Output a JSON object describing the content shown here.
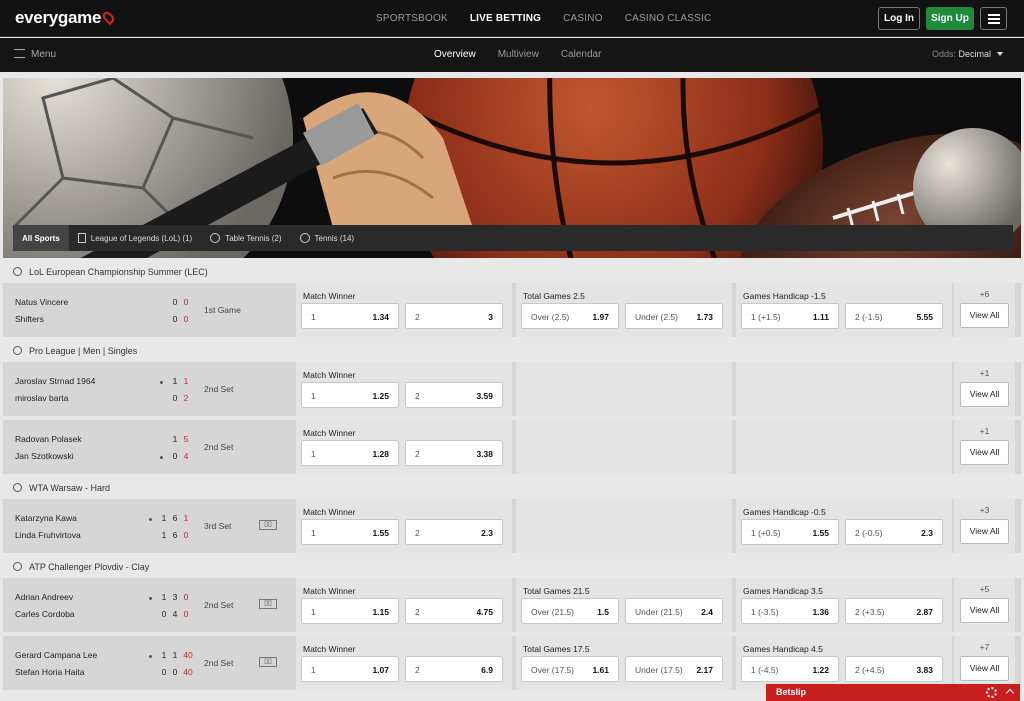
{
  "header": {
    "logo": "everygame",
    "nav": [
      "SPORTSBOOK",
      "LIVE BETTING",
      "CASINO",
      "CASINO CLASSIC"
    ],
    "active_nav": "LIVE BETTING",
    "login": "Log In",
    "signup": "Sign Up"
  },
  "subheader": {
    "menu": "Menu",
    "tabs": [
      "Overview",
      "Multiview",
      "Calendar"
    ],
    "active_tab": "Overview",
    "odds_label": "Odds:",
    "odds_value": "Decimal"
  },
  "sport_tabs": [
    "All Sports",
    "League of Legends (LoL) (1)",
    "Table Tennis (2)",
    "Tennis (14)"
  ],
  "leagues": [
    {
      "name": "LoL European Championship Summer (LEC)",
      "icon": "lol-icon",
      "matches": [
        {
          "p1": "Natus Vincere",
          "p2": "Shifters",
          "s1": [
            "0",
            "0"
          ],
          "s2": [
            "0",
            "0"
          ],
          "period": "1st Game",
          "stats": false,
          "markets": [
            {
              "title": "Match Winner",
              "odds": [
                [
                  "1",
                  "1.34"
                ],
                [
                  "2",
                  "3"
                ]
              ]
            },
            {
              "title": "Total Games 2.5",
              "odds": [
                [
                  "Over (2.5)",
                  "1.97"
                ],
                [
                  "Under (2.5)",
                  "1.73"
                ]
              ]
            },
            {
              "title": "Games Handicap -1.5",
              "odds": [
                [
                  "1 (+1.5)",
                  "1.11"
                ],
                [
                  "2 (-1.5)",
                  "5.55"
                ]
              ]
            }
          ],
          "more": "+6",
          "view_all": "View All"
        }
      ]
    },
    {
      "name": "Pro League | Men | Singles",
      "icon": "table-tennis-icon",
      "matches": [
        {
          "p1": "Jaroslav Strnad 1964",
          "p2": "miroslav barta",
          "s1": [
            "1",
            "1"
          ],
          "s2": [
            "0",
            "2"
          ],
          "serve": 1,
          "period": "2nd Set",
          "stats": false,
          "markets": [
            {
              "title": "Match Winner",
              "odds": [
                [
                  "1",
                  "1.25"
                ],
                [
                  "2",
                  "3.59"
                ]
              ]
            },
            null,
            null
          ],
          "more": "+1",
          "view_all": "View All"
        },
        {
          "p1": "Radovan Polasek",
          "p2": "Jan Szotkowski",
          "s1": [
            "1",
            "5"
          ],
          "s2": [
            "0",
            "4"
          ],
          "serve": 2,
          "period": "2nd Set",
          "stats": false,
          "markets": [
            {
              "title": "Match Winner",
              "odds": [
                [
                  "1",
                  "1.28"
                ],
                [
                  "2",
                  "3.38"
                ]
              ]
            },
            null,
            null
          ],
          "more": "+1",
          "view_all": "View All"
        }
      ]
    },
    {
      "name": "WTA Warsaw - Hard",
      "icon": "tennis-icon",
      "matches": [
        {
          "p1": "Katarzyna Kawa",
          "p2": "Linda Fruhvirtova",
          "s1": [
            "1",
            "6",
            "1"
          ],
          "s2": [
            "1",
            "6",
            "0"
          ],
          "serve": 1,
          "period": "3rd Set",
          "stats": true,
          "markets": [
            {
              "title": "Match Winner",
              "odds": [
                [
                  "1",
                  "1.55"
                ],
                [
                  "2",
                  "2.3"
                ]
              ]
            },
            null,
            {
              "title": "Games Handicap -0.5",
              "odds": [
                [
                  "1 (+0.5)",
                  "1.55"
                ],
                [
                  "2 (-0.5)",
                  "2.3"
                ]
              ]
            }
          ],
          "more": "+3",
          "view_all": "View All"
        }
      ]
    },
    {
      "name": "ATP Challenger Plovdiv - Clay",
      "icon": "tennis-icon",
      "matches": [
        {
          "p1": "Adrian Andreev",
          "p2": "Carles Cordoba",
          "s1": [
            "1",
            "3",
            "0"
          ],
          "s2": [
            "0",
            "4",
            "0"
          ],
          "serve": 1,
          "period": "2nd Set",
          "stats": true,
          "markets": [
            {
              "title": "Match Winner",
              "odds": [
                [
                  "1",
                  "1.15"
                ],
                [
                  "2",
                  "4.75"
                ]
              ]
            },
            {
              "title": "Total Games 21.5",
              "odds": [
                [
                  "Over (21.5)",
                  "1.5"
                ],
                [
                  "Under (21.5)",
                  "2.4"
                ]
              ]
            },
            {
              "title": "Games Handicap 3.5",
              "odds": [
                [
                  "1 (-3.5)",
                  "1.36"
                ],
                [
                  "2 (+3.5)",
                  "2.87"
                ]
              ]
            }
          ],
          "more": "+5",
          "view_all": "View All"
        },
        {
          "p1": "Gerard Campana Lee",
          "p2": "Stefan Horia Haita",
          "s1": [
            "1",
            "1",
            "40"
          ],
          "s2": [
            "0",
            "0",
            "40"
          ],
          "serve": 1,
          "period": "2nd Set",
          "stats": true,
          "markets": [
            {
              "title": "Match Winner",
              "odds": [
                [
                  "1",
                  "1.07"
                ],
                [
                  "2",
                  "6.9"
                ]
              ]
            },
            {
              "title": "Total Games 17.5",
              "odds": [
                [
                  "Over (17.5)",
                  "1.61"
                ],
                [
                  "Under (17.5)",
                  "2.17"
                ]
              ]
            },
            {
              "title": "Games Handicap 4.5",
              "odds": [
                [
                  "1 (-4.5)",
                  "1.22"
                ],
                [
                  "2 (+4.5)",
                  "3.83"
                ]
              ]
            }
          ],
          "more": "+7",
          "view_all": "View All"
        }
      ]
    }
  ],
  "betslip": "Betslip",
  "colors": {
    "accent_red": "#c81e1e",
    "signup_green": "#1f8a3b",
    "header_bg": "#121212",
    "score_red": "#c62828"
  }
}
